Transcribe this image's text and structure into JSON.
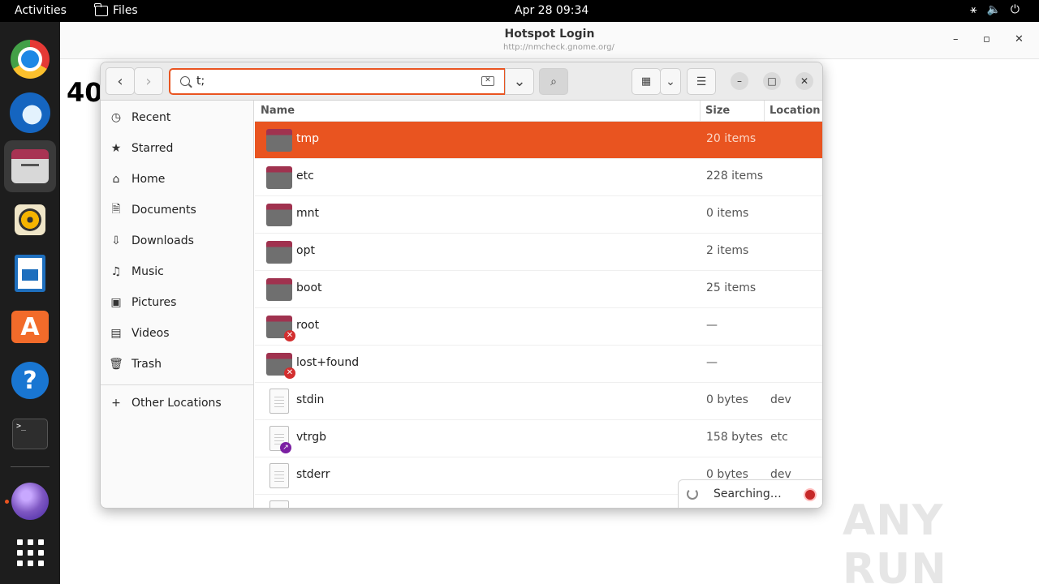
{
  "topbar": {
    "activities": "Activities",
    "app_name": "Files",
    "datetime": "Apr 28  09:34",
    "tray_icons": [
      "network-icon",
      "volume-icon",
      "power-icon"
    ]
  },
  "dock": {
    "items": [
      "chrome",
      "thunderbird",
      "files",
      "rhythmbox",
      "libreoffice-writer",
      "app-center",
      "help",
      "terminal",
      "globe-browser",
      "show-apps"
    ],
    "terminal_glyph": ">_"
  },
  "browser": {
    "title": "Hotspot Login",
    "url": "http://nmcheck.gnome.org/",
    "page_text": "40"
  },
  "files": {
    "search": {
      "value": "t;"
    },
    "sidebar": {
      "items": [
        {
          "label": "Recent",
          "icon": "clock-icon"
        },
        {
          "label": "Starred",
          "icon": "star-icon"
        },
        {
          "label": "Home",
          "icon": "home-icon"
        },
        {
          "label": "Documents",
          "icon": "document-icon"
        },
        {
          "label": "Downloads",
          "icon": "download-icon"
        },
        {
          "label": "Music",
          "icon": "music-icon"
        },
        {
          "label": "Pictures",
          "icon": "picture-icon"
        },
        {
          "label": "Videos",
          "icon": "video-icon"
        },
        {
          "label": "Trash",
          "icon": "trash-icon"
        }
      ],
      "other_locations": "Other Locations"
    },
    "columns": {
      "name": "Name",
      "size": "Size",
      "location": "Location"
    },
    "rows": [
      {
        "name": "tmp",
        "size": "20 items",
        "location": "",
        "type": "folder",
        "selected": true
      },
      {
        "name": "etc",
        "size": "228 items",
        "location": "",
        "type": "folder"
      },
      {
        "name": "mnt",
        "size": "0 items",
        "location": "",
        "type": "folder"
      },
      {
        "name": "opt",
        "size": "2 items",
        "location": "",
        "type": "folder"
      },
      {
        "name": "boot",
        "size": "25 items",
        "location": "",
        "type": "folder"
      },
      {
        "name": "root",
        "size": "—",
        "location": "",
        "type": "folder-locked"
      },
      {
        "name": "lost+found",
        "size": "—",
        "location": "",
        "type": "folder-locked"
      },
      {
        "name": "stdin",
        "size": "0 bytes",
        "location": "dev",
        "type": "file"
      },
      {
        "name": "vtrgb",
        "size": "158 bytes",
        "location": "etc",
        "type": "file-link"
      },
      {
        "name": "stderr",
        "size": "0 bytes",
        "location": "dev",
        "type": "file"
      }
    ],
    "status": "Searching…",
    "colors": {
      "accent": "#e95420",
      "folder_top": "#a0324f"
    }
  },
  "watermark": "ANY RUN"
}
